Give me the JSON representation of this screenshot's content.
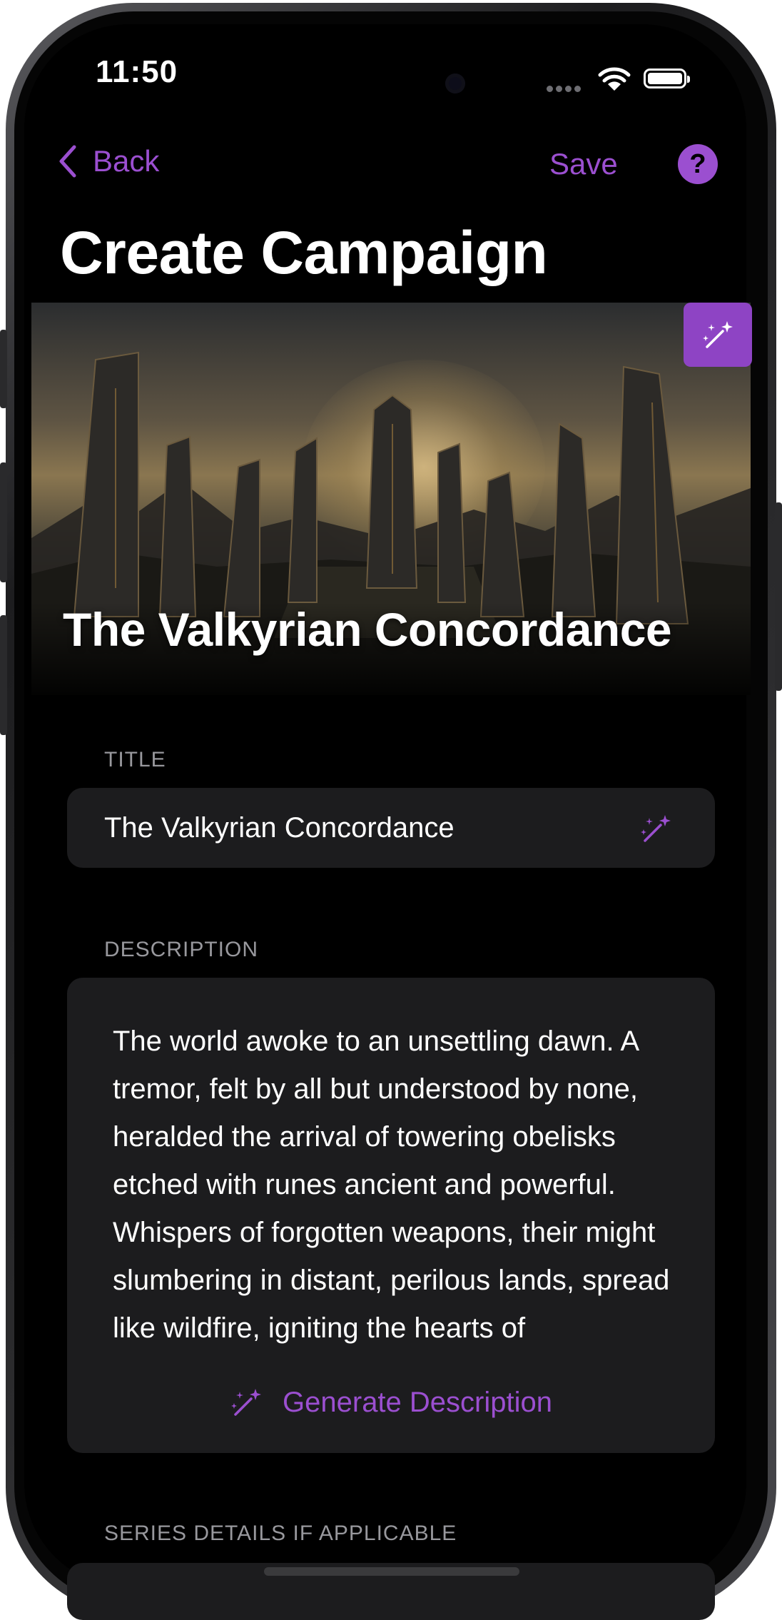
{
  "status_bar": {
    "time": "11:50"
  },
  "nav": {
    "back_label": "Back",
    "save_label": "Save",
    "help_label": "?"
  },
  "page_title": "Create Campaign",
  "hero": {
    "title": "The Valkyrian Concordance",
    "image_alt": "standing-stones-obelisks"
  },
  "form": {
    "title_label": "TITLE",
    "title_value": "The Valkyrian Concordance",
    "description_label": "DESCRIPTION",
    "description_value": "The world awoke to an unsettling dawn. A tremor, felt by all but understood by none, heralded the arrival of towering obelisks etched with runes ancient and powerful. Whispers of forgotten weapons, their might slumbering in distant, perilous lands, spread like wildfire, igniting the hearts of",
    "generate_label": "Generate Description",
    "series_label": "SERIES DETAILS IF APPLICABLE"
  },
  "colors": {
    "accent": "#9b4fd0",
    "accent_button": "#8e44c4",
    "card": "#1c1c1e",
    "background": "#000000"
  }
}
